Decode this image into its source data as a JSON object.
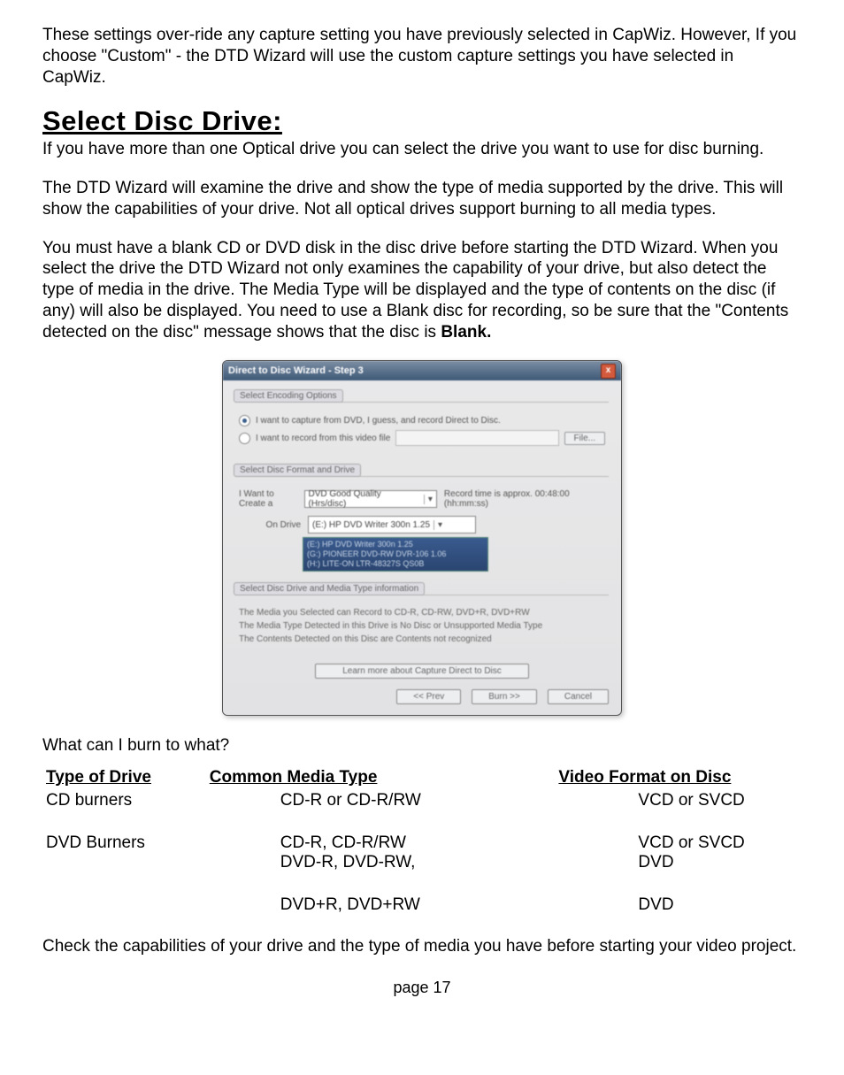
{
  "intro_para": "These settings over-ride any capture setting you have previously selected in CapWiz. However, If you choose \"Custom\" - the DTD Wizard will use the custom capture settings you have selected in CapWiz.",
  "heading": "Select Disc Drive:",
  "p1": "If you have more than one Optical drive you can select the drive you want to use for disc burning.",
  "p2": "The DTD Wizard will examine the drive and show the type of media supported by the drive. This will show the capabilities of your drive. Not all optical drives support burning to all media types.",
  "p3_a": "You must have a blank CD or DVD disk in the disc drive before starting the DTD Wizard.  When you select the drive the DTD Wizard not only examines the capability of your drive, but also detect the type of media in the drive. The Media Type will be displayed and the type of contents on the disc (if any) will also be displayed. You need to use a Blank disc for recording, so be sure that the \"Contents detected on the disc\" message shows that the disc is ",
  "p3_bold": "Blank.",
  "dialog": {
    "title": "Direct to Disc Wizard - Step 3",
    "close": "x",
    "group1_tab": "Select Encoding Options",
    "radio1": "I want to capture from DVD, I guess, and record Direct to Disc.",
    "radio2": "I want to record from this video file",
    "file_btn": "File...",
    "group2_tab": "Select Disc Format and Drive",
    "format_label": "I Want to Create a",
    "format_combo": "DVD Good Quality (Hrs/disc)",
    "format_hint": "Record time is approx. 00:48:00 (hh:mm:ss)",
    "drive_label": "On Drive",
    "drive_combo": "(E:)  HP DVD Writer 300n  1.25",
    "drive_info": "(E:)  HP DVD Writer 300n  1.25\n(G:)  PIONEER  DVD-RW DVR-106  1.06\n(H:)  LITE-ON LTR-48327S  QS0B",
    "media_tab": "Select Disc Drive and Media Type information",
    "line1": "The Media you Selected can Record to     CD-R, CD-RW, DVD+R, DVD+RW",
    "line2": "The Media Type Detected in this Drive is   No Disc or Unsupported Media Type",
    "line3": "The Contents Detected on this Disc are    Contents not recognized",
    "learn_btn": "Learn more about Capture Direct to Disc",
    "back_btn": "<< Prev",
    "next_btn": "Burn >>",
    "cancel_btn": "Cancel"
  },
  "burn_q": "What can I burn to what?",
  "table": {
    "h_drive": "Type of Drive",
    "h_media": "Common Media Type",
    "h_video": "Video Format on Disc",
    "rows": [
      {
        "drive": "CD burners",
        "media": "CD-R or CD-R/RW",
        "video": "VCD or SVCD"
      },
      {
        "drive": "DVD Burners",
        "media": "CD-R, CD-R/RW\nDVD-R, DVD-RW,",
        "video": "VCD or SVCD\nDVD"
      },
      {
        "drive": "",
        "media": "DVD+R, DVD+RW",
        "video": "DVD"
      }
    ]
  },
  "closing": "Check the capabilities of your drive and the type of media you have before starting your video project.",
  "footer": "page 17"
}
